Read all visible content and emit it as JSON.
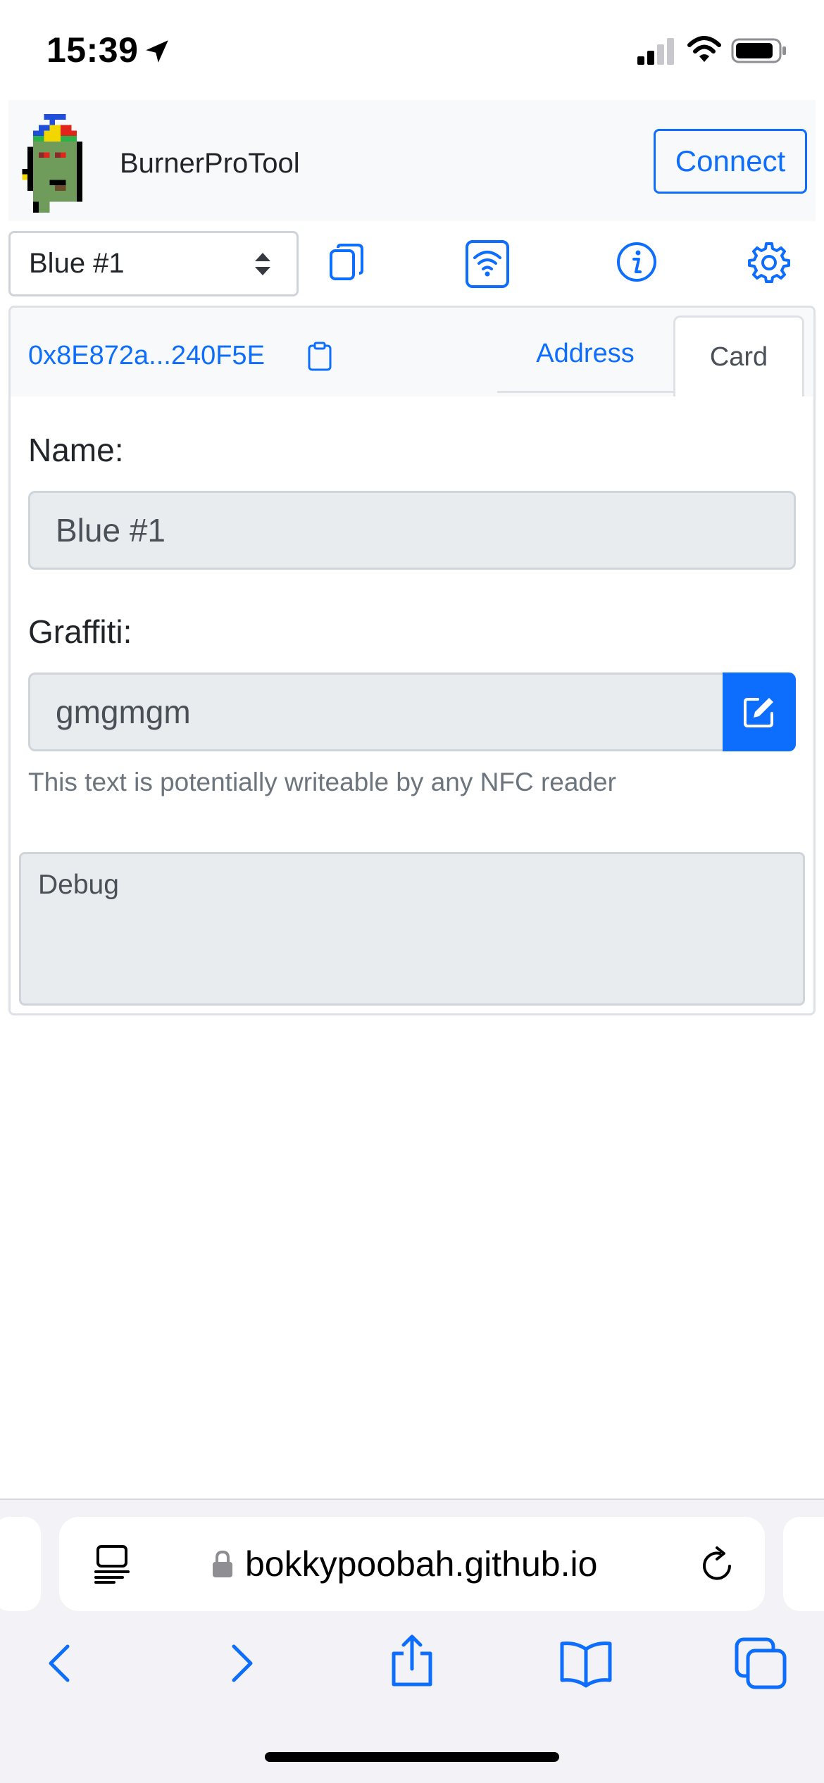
{
  "status_bar": {
    "time": "15:39"
  },
  "navbar": {
    "brand": "BurnerProTool",
    "connect_label": "Connect"
  },
  "toolbar": {
    "selected_card": "Blue #1",
    "icons": [
      "copy-icon",
      "nfc-wifi-icon",
      "info-icon",
      "gear-icon"
    ]
  },
  "card_panel": {
    "address": "0x8E872a...240F5E",
    "tabs": [
      {
        "label": "Address",
        "active": false
      },
      {
        "label": "Card",
        "active": true
      }
    ],
    "name_label": "Name:",
    "name_value": "Blue #1",
    "graffiti_label": "Graffiti:",
    "graffiti_value": "gmgmgm",
    "help_text": "This text is potentially writeable by any NFC reader",
    "debug_label": "Debug"
  },
  "browser": {
    "url": "bokkypoobah.github.io"
  },
  "colors": {
    "primary": "#0d6efd",
    "input_bg": "#e9ecef",
    "muted": "#6c757d",
    "navbar_bg": "#f8f9fa"
  }
}
